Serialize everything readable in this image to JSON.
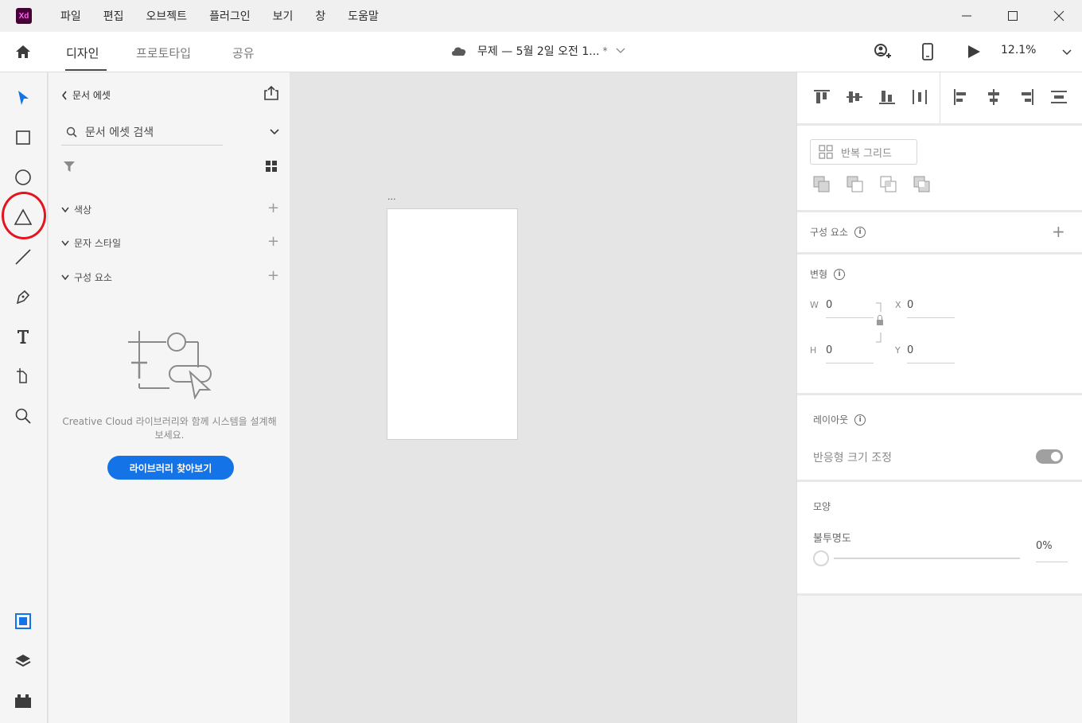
{
  "app": {
    "logo_text": "Xd"
  },
  "menu": [
    "파일",
    "편집",
    "오브젝트",
    "플러그인",
    "보기",
    "창",
    "도움말"
  ],
  "modes": {
    "design": "디자인",
    "prototype": "프로토타입",
    "share": "공유"
  },
  "document": {
    "title": "무제 — 5월 2일 오전 1...",
    "modified_mark": "*"
  },
  "zoom": "12.1%",
  "assets": {
    "back_label": "문서 에셋",
    "search_placeholder": "문서 에셋 검색",
    "sections": [
      "색상",
      "문자 스타일",
      "구성 요소"
    ],
    "empty_text": "Creative Cloud 라이브러리와 함께 시스템을 설계해 보세요.",
    "browse_button": "라이브러리 찾아보기"
  },
  "canvas": {
    "artboard_label": "..."
  },
  "inspector": {
    "repeat_grid": "반복 그리드",
    "components": "구성 요소",
    "transform": "변형",
    "w_key": "W",
    "w": "0",
    "h_key": "H",
    "h": "0",
    "x_key": "X",
    "x": "0",
    "y_key": "Y",
    "y": "0",
    "layout": "레이아웃",
    "responsive": "반응형 크기 조정",
    "appearance": "모양",
    "opacity_label": "불투명도",
    "opacity": "0%"
  },
  "colors": {
    "accent": "#1473e6",
    "highlight_ring": "#e3151f",
    "select_tool": "#1473e6"
  }
}
